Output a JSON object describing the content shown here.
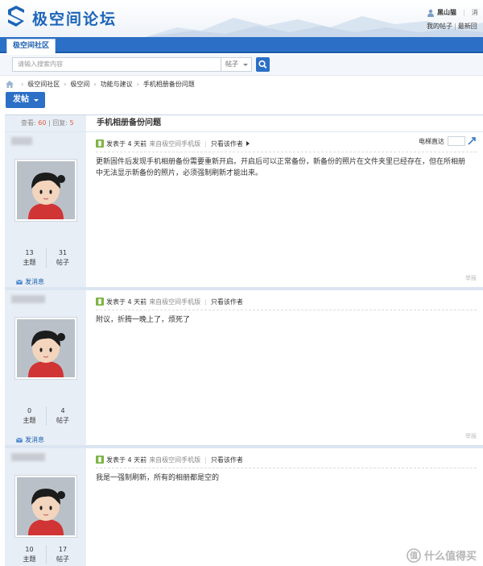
{
  "header": {
    "site_name": "极空间论坛",
    "username": "黑山猫",
    "user_extra": "消",
    "my_posts": "我的帖子",
    "latest_reply": "最新回"
  },
  "nav": {
    "tab_label": "极空间社区"
  },
  "search": {
    "placeholder": "请输入搜索内容",
    "type_label": "帖子"
  },
  "breadcrumb": [
    "极空间社区",
    "极空间",
    "功能与建议",
    "手机相册备份问题"
  ],
  "post_button": {
    "label": "发帖"
  },
  "thread": {
    "views_label": "查看:",
    "views": "60",
    "sep": "|",
    "replies_label": "回复:",
    "replies": "5",
    "title": "手机相册备份问题"
  },
  "labels": {
    "topics": "主题",
    "posts": "帖子",
    "send_message": "发消息",
    "posted_prefix": "发表于 4 天前",
    "posted_from": "来自极空间手机版",
    "only_author": "只看该作者",
    "floor_jump": "电梯直达",
    "report": "举报"
  },
  "posts": [
    {
      "topics": "13",
      "posts": "31",
      "content": "更新固件后发现手机相册备份需要重新开启。开启后可以正常备份，新备份的照片在文件夹里已经存在，但在所相册中无法显示新备份的照片，必须强制刷新才能出来。"
    },
    {
      "topics": "0",
      "posts": "4",
      "content": "附议，折腾一晚上了，烦死了"
    },
    {
      "topics": "10",
      "posts": "17",
      "content": "我是一强制刷新，所有的相册都是空的"
    }
  ],
  "watermark": {
    "text": "什么值得买"
  },
  "colors": {
    "primary": "#2b6fc6",
    "side_bg": "#e8eef6",
    "accent_red": "#e05a3a"
  }
}
